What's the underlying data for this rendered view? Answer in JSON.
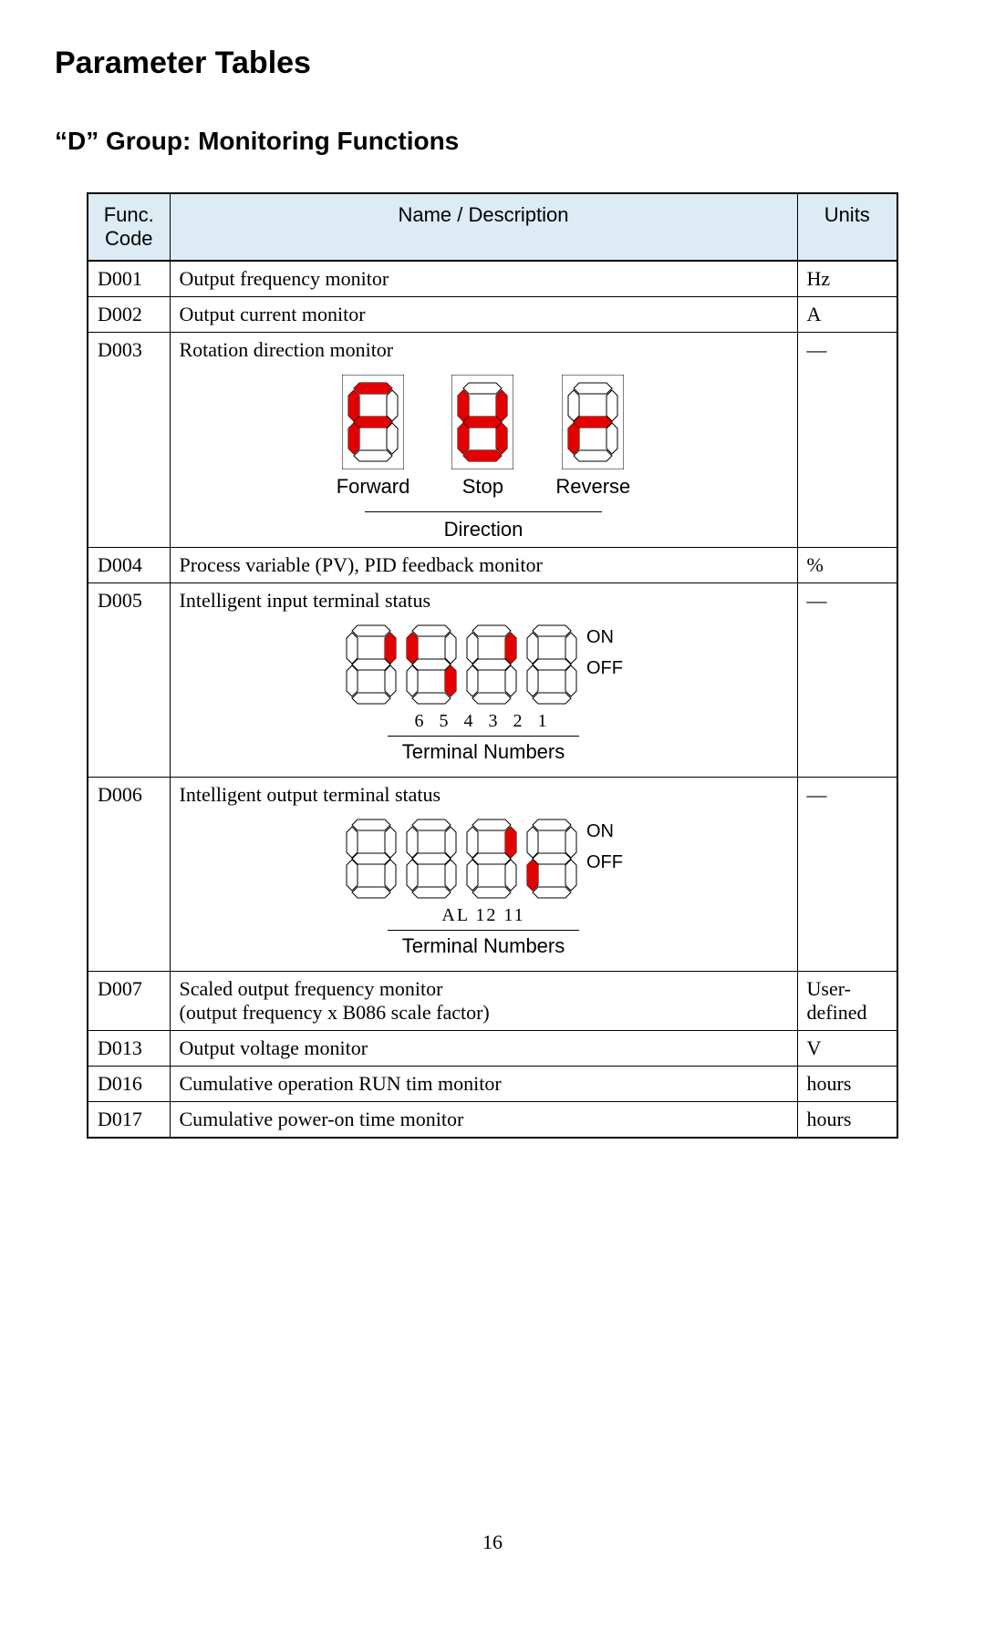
{
  "page_title": "Parameter Tables",
  "section_title": "“D” Group: Monitoring Functions",
  "headers": {
    "code": "Func.\nCode",
    "name": "Name / Description",
    "units": "Units"
  },
  "rows": [
    {
      "code": "D001",
      "name": "Output frequency monitor",
      "units": "Hz"
    },
    {
      "code": "D002",
      "name": "Output current monitor",
      "units": "A"
    },
    {
      "code": "D003",
      "name": "Rotation direction monitor",
      "units": "—",
      "diagram": {
        "labels": {
          "forward": "Forward",
          "stop": "Stop",
          "reverse": "Reverse",
          "direction": "Direction"
        }
      }
    },
    {
      "code": "D004",
      "name": "Process variable (PV), PID feedback monitor",
      "units": "%"
    },
    {
      "code": "D005",
      "name": "Intelligent input terminal status",
      "units": "—",
      "diagram": {
        "on": "ON",
        "off": "OFF",
        "numbers": "6   5  4   3  2   1",
        "caption": "Terminal Numbers"
      }
    },
    {
      "code": "D006",
      "name": "Intelligent output terminal status",
      "units": "—",
      "diagram": {
        "on": "ON",
        "off": "OFF",
        "numbers": "AL  12  11",
        "caption": "Terminal Numbers"
      }
    },
    {
      "code": "D007",
      "name": "Scaled output frequency monitor\n(output frequency x B086 scale factor)",
      "units": "User-\ndefined"
    },
    {
      "code": "D013",
      "name": "Output voltage monitor",
      "units": "V"
    },
    {
      "code": "D016",
      "name": "Cumulative operation RUN tim monitor",
      "units": "hours"
    },
    {
      "code": "D017",
      "name": "Cumulative power-on time monitor",
      "units": "hours"
    }
  ],
  "page_number": "16"
}
